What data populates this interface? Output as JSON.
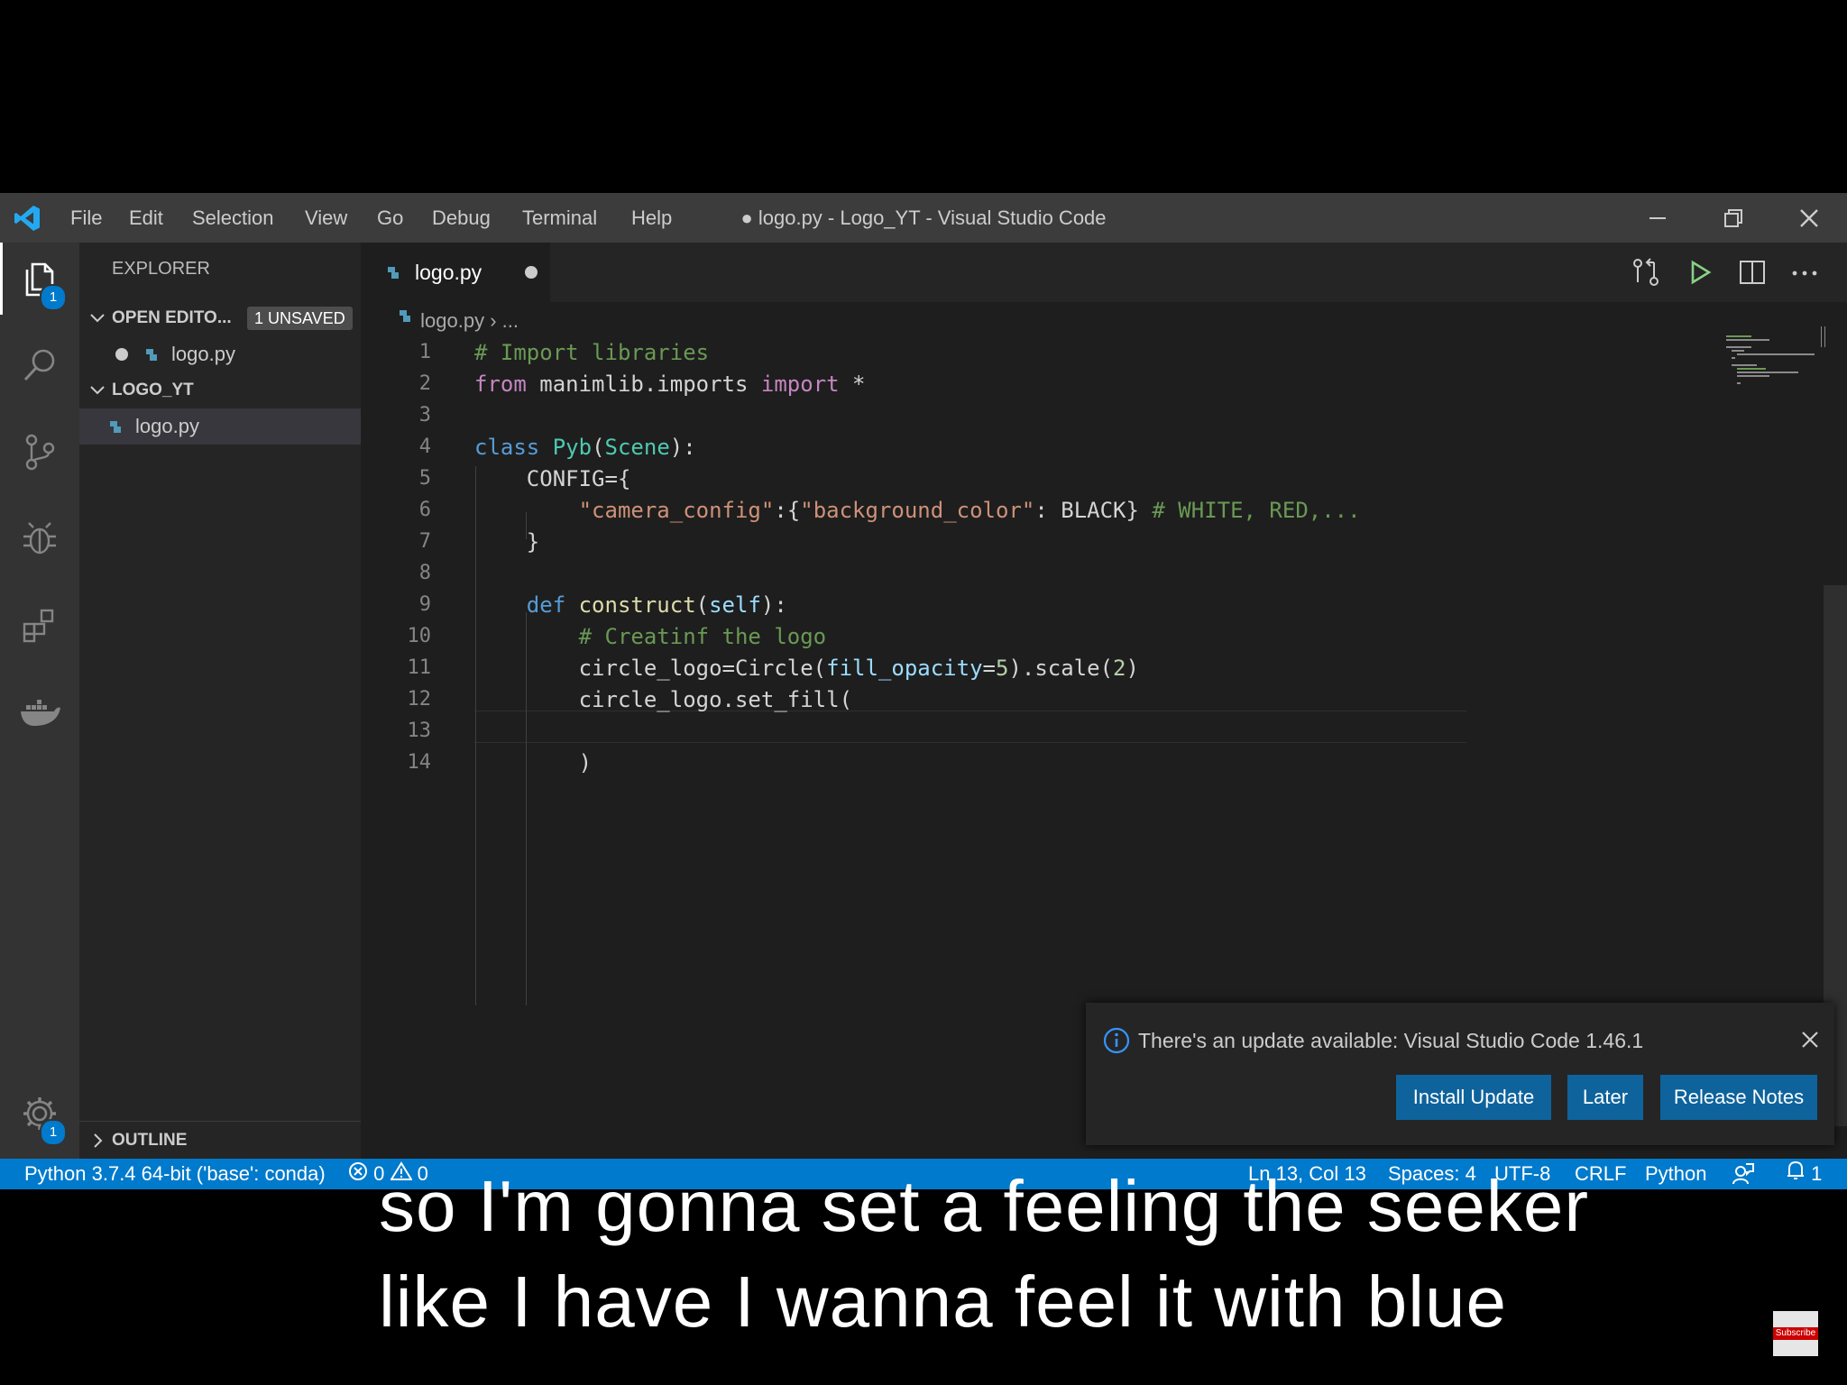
{
  "window": {
    "title": "● logo.py - Logo_YT - Visual Studio Code",
    "menu": [
      "File",
      "Edit",
      "Selection",
      "View",
      "Go",
      "Debug",
      "Terminal",
      "Help"
    ]
  },
  "activity_bar": {
    "explorer_badge": "1",
    "settings_badge": "1"
  },
  "sidebar": {
    "title": "EXPLORER",
    "open_editors": {
      "label": "OPEN EDITO...",
      "badge": "1 UNSAVED",
      "file": "logo.py"
    },
    "folder": {
      "label": "LOGO_YT",
      "file": "logo.py"
    },
    "outline": "OUTLINE"
  },
  "editor": {
    "tab": {
      "label": "logo.py",
      "dirty": true
    },
    "breadcrumb": {
      "file": "logo.py",
      "rest": "..."
    },
    "line_numbers": [
      "1",
      "2",
      "3",
      "4",
      "5",
      "6",
      "7",
      "8",
      "9",
      "10",
      "11",
      "12",
      "13",
      "14"
    ],
    "lines": [
      "# Import libraries",
      "from manimlib.imports import *",
      "",
      "class Pyb(Scene):",
      "    CONFIG={",
      "        \"camera_config\":{\"background_color\": BLACK} # WHITE, RED,...",
      "    }",
      "",
      "    def construct(self):",
      "        # Creatinf the logo",
      "        circle_logo=Circle(fill_opacity=5).scale(2)",
      "        circle_logo.set_fill(",
      "",
      "        )"
    ]
  },
  "notification": {
    "message": "There's an update available: Visual Studio Code 1.46.1",
    "install": "Install Update",
    "later": "Later",
    "release_notes": "Release Notes"
  },
  "status_bar": {
    "interpreter": "Python 3.7.4 64-bit ('base': conda)",
    "errors": "0",
    "warnings": "0",
    "position": "Ln 13, Col 13",
    "spaces": "Spaces: 4",
    "encoding": "UTF-8",
    "eol": "CRLF",
    "language": "Python",
    "notifications": "1"
  },
  "captions": [
    "so I'm gonna set a feeling the seeker",
    "like I have I wanna feel it with blue"
  ],
  "overlay": {
    "subscribe": "Subscribe"
  }
}
